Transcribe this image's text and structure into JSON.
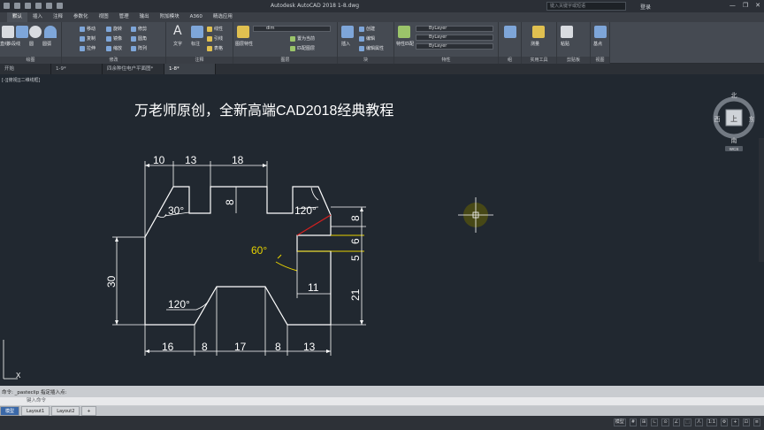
{
  "titlebar": {
    "app_title": "Autodesk AutoCAD 2018      1-8.dwg",
    "search_placeholder": "键入关键字或短语",
    "login": "登录",
    "min": "—",
    "max": "❐",
    "close": "✕"
  },
  "ribbon_tabs": [
    "默认",
    "插入",
    "注释",
    "参数化",
    "视图",
    "管理",
    "输出",
    "附加模块",
    "A360",
    "精选应用"
  ],
  "ribbon": {
    "draw_label": "绘图",
    "modify_label": "修改",
    "annotation_label": "注释",
    "layers_label": "图层",
    "block_label": "块",
    "properties_label": "特性",
    "groups_label": "组",
    "utilities_label": "实用工具",
    "clipboard_label": "剪贴板",
    "view_label": "视图",
    "draw_items": [
      "直线",
      "多段线",
      "圆",
      "圆弧"
    ],
    "modify_items": [
      "移动",
      "旋转",
      "修剪",
      "复制",
      "镜像",
      "圆角",
      "拉伸",
      "缩放",
      "阵列"
    ],
    "annotation_items": [
      "文字",
      "标注",
      "线性",
      "引线",
      "表格"
    ],
    "layer_name": "dim",
    "layer_items": [
      "图层特性",
      "置为当前",
      "匹配图层"
    ],
    "block_items": [
      "插入",
      "创建",
      "编辑",
      "编辑属性"
    ],
    "properties_items": [
      "特性匹配"
    ],
    "bylayer": [
      "ByLayer",
      "ByLayer",
      "ByLayer"
    ],
    "utility_items": [
      "测量"
    ],
    "clipboard_items": [
      "粘贴"
    ],
    "view_items": [
      "基点"
    ]
  },
  "file_tabs": [
    "开始",
    "1-9*",
    "四余种住电户平面图*",
    "1-8*"
  ],
  "viewport_label": "[-][俯视][二维线框]",
  "drawing": {
    "title_text": "万老师原创，全新高端CAD2018经典教程",
    "dims": {
      "top": [
        "10",
        "13",
        "18"
      ],
      "bottom": [
        "16",
        "8",
        "17",
        "8",
        "13"
      ],
      "left": "30",
      "right": [
        "8",
        "6",
        "5",
        "21"
      ],
      "inner_8": "8",
      "inner_11": "11"
    },
    "angles": [
      "30°",
      "120°",
      "60°",
      "120°"
    ]
  },
  "navcube": {
    "north": "北",
    "south": "南",
    "west": "西",
    "east": "东",
    "top": "上",
    "wcs": "WCS"
  },
  "command": {
    "history": "命令: _pasteclip 指定插入点:",
    "placeholder": "键入命令"
  },
  "layout_tabs": [
    "模型",
    "Layout1",
    "Layout2",
    "+"
  ],
  "status": [
    "模型",
    "#",
    "⊞",
    "∟",
    "⊙",
    "∠",
    "⬚",
    "人",
    "1:1",
    "⚙",
    "+",
    "⊡",
    "≡"
  ],
  "colors": {
    "background": "#212830",
    "linework": "#ffffff",
    "accent_yellow": "#e6d200",
    "accent_red": "#d42020"
  }
}
